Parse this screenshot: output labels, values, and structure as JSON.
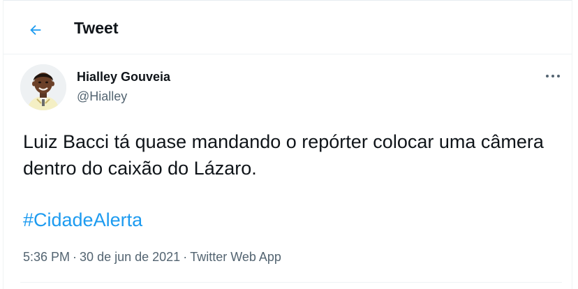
{
  "header": {
    "back_icon": "arrow-left-icon",
    "title": "Tweet"
  },
  "tweet": {
    "author_name": "Hialley Gouveia",
    "author_handle": "@Hialley",
    "more_icon": "more-dots-icon",
    "text": "Luiz Bacci tá quase mandando o repórter colocar uma câmera dentro do caixão do Lázaro.",
    "hashtag": "#CidadeAlerta",
    "time": "5:36 PM",
    "date": "30 de jun de 2021",
    "source": "Twitter Web App",
    "separator": "·"
  },
  "colors": {
    "accent": "#1d9bf0",
    "text": "#0f1419",
    "secondary": "#536471"
  }
}
